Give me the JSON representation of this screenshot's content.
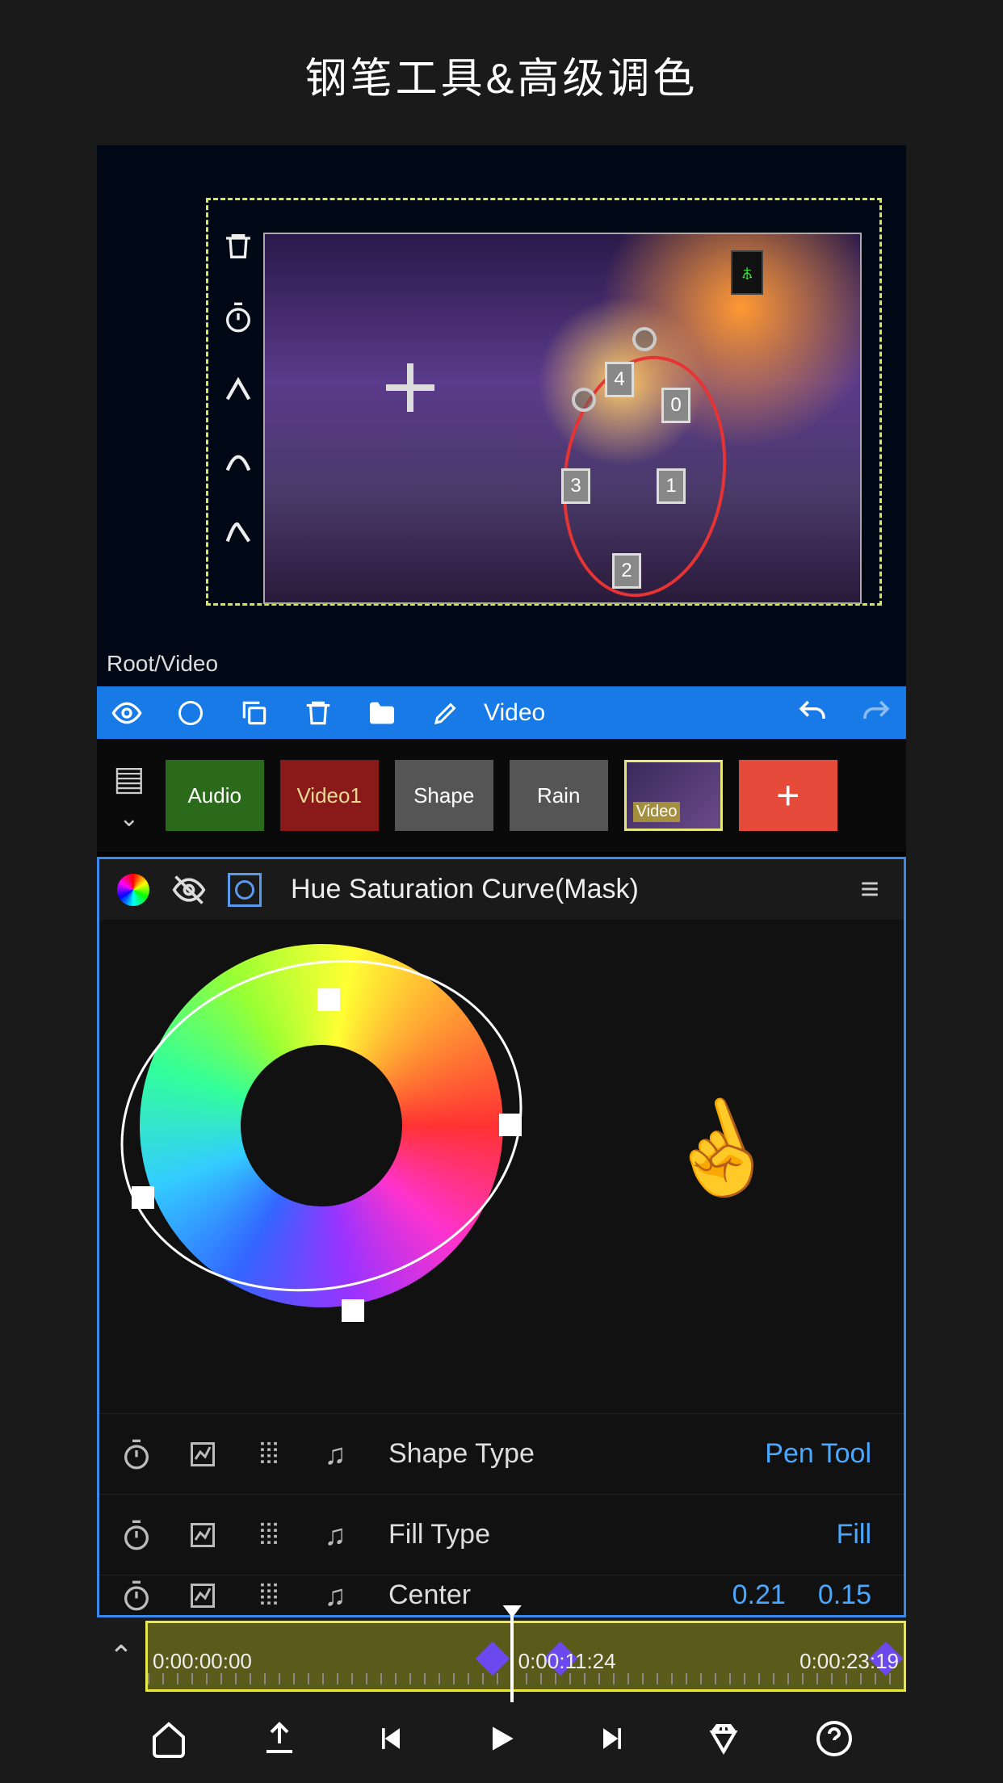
{
  "title": "钢笔工具&高级调色",
  "preview": {
    "path_label": "Root/Video",
    "anchors": [
      "0",
      "1",
      "2",
      "3",
      "4"
    ]
  },
  "toolbar": {
    "layer_name": "Video"
  },
  "layers": [
    {
      "label": "Audio",
      "type": "audio"
    },
    {
      "label": "Video1",
      "type": "video1"
    },
    {
      "label": "Shape",
      "type": "shape"
    },
    {
      "label": "Rain",
      "type": "rain"
    },
    {
      "label": "Video",
      "type": "video-sel"
    }
  ],
  "curve_panel": {
    "title": "Hue Saturation Curve(Mask)"
  },
  "params": [
    {
      "label": "Shape Type",
      "value": "Pen Tool"
    },
    {
      "label": "Fill Type",
      "value": "Fill"
    },
    {
      "label": "Center",
      "value": "0.21",
      "value2": "0.15"
    }
  ],
  "timeline": {
    "start": "0:00:00:00",
    "current": "0:00:11:24",
    "end": "0:00:23:19"
  }
}
